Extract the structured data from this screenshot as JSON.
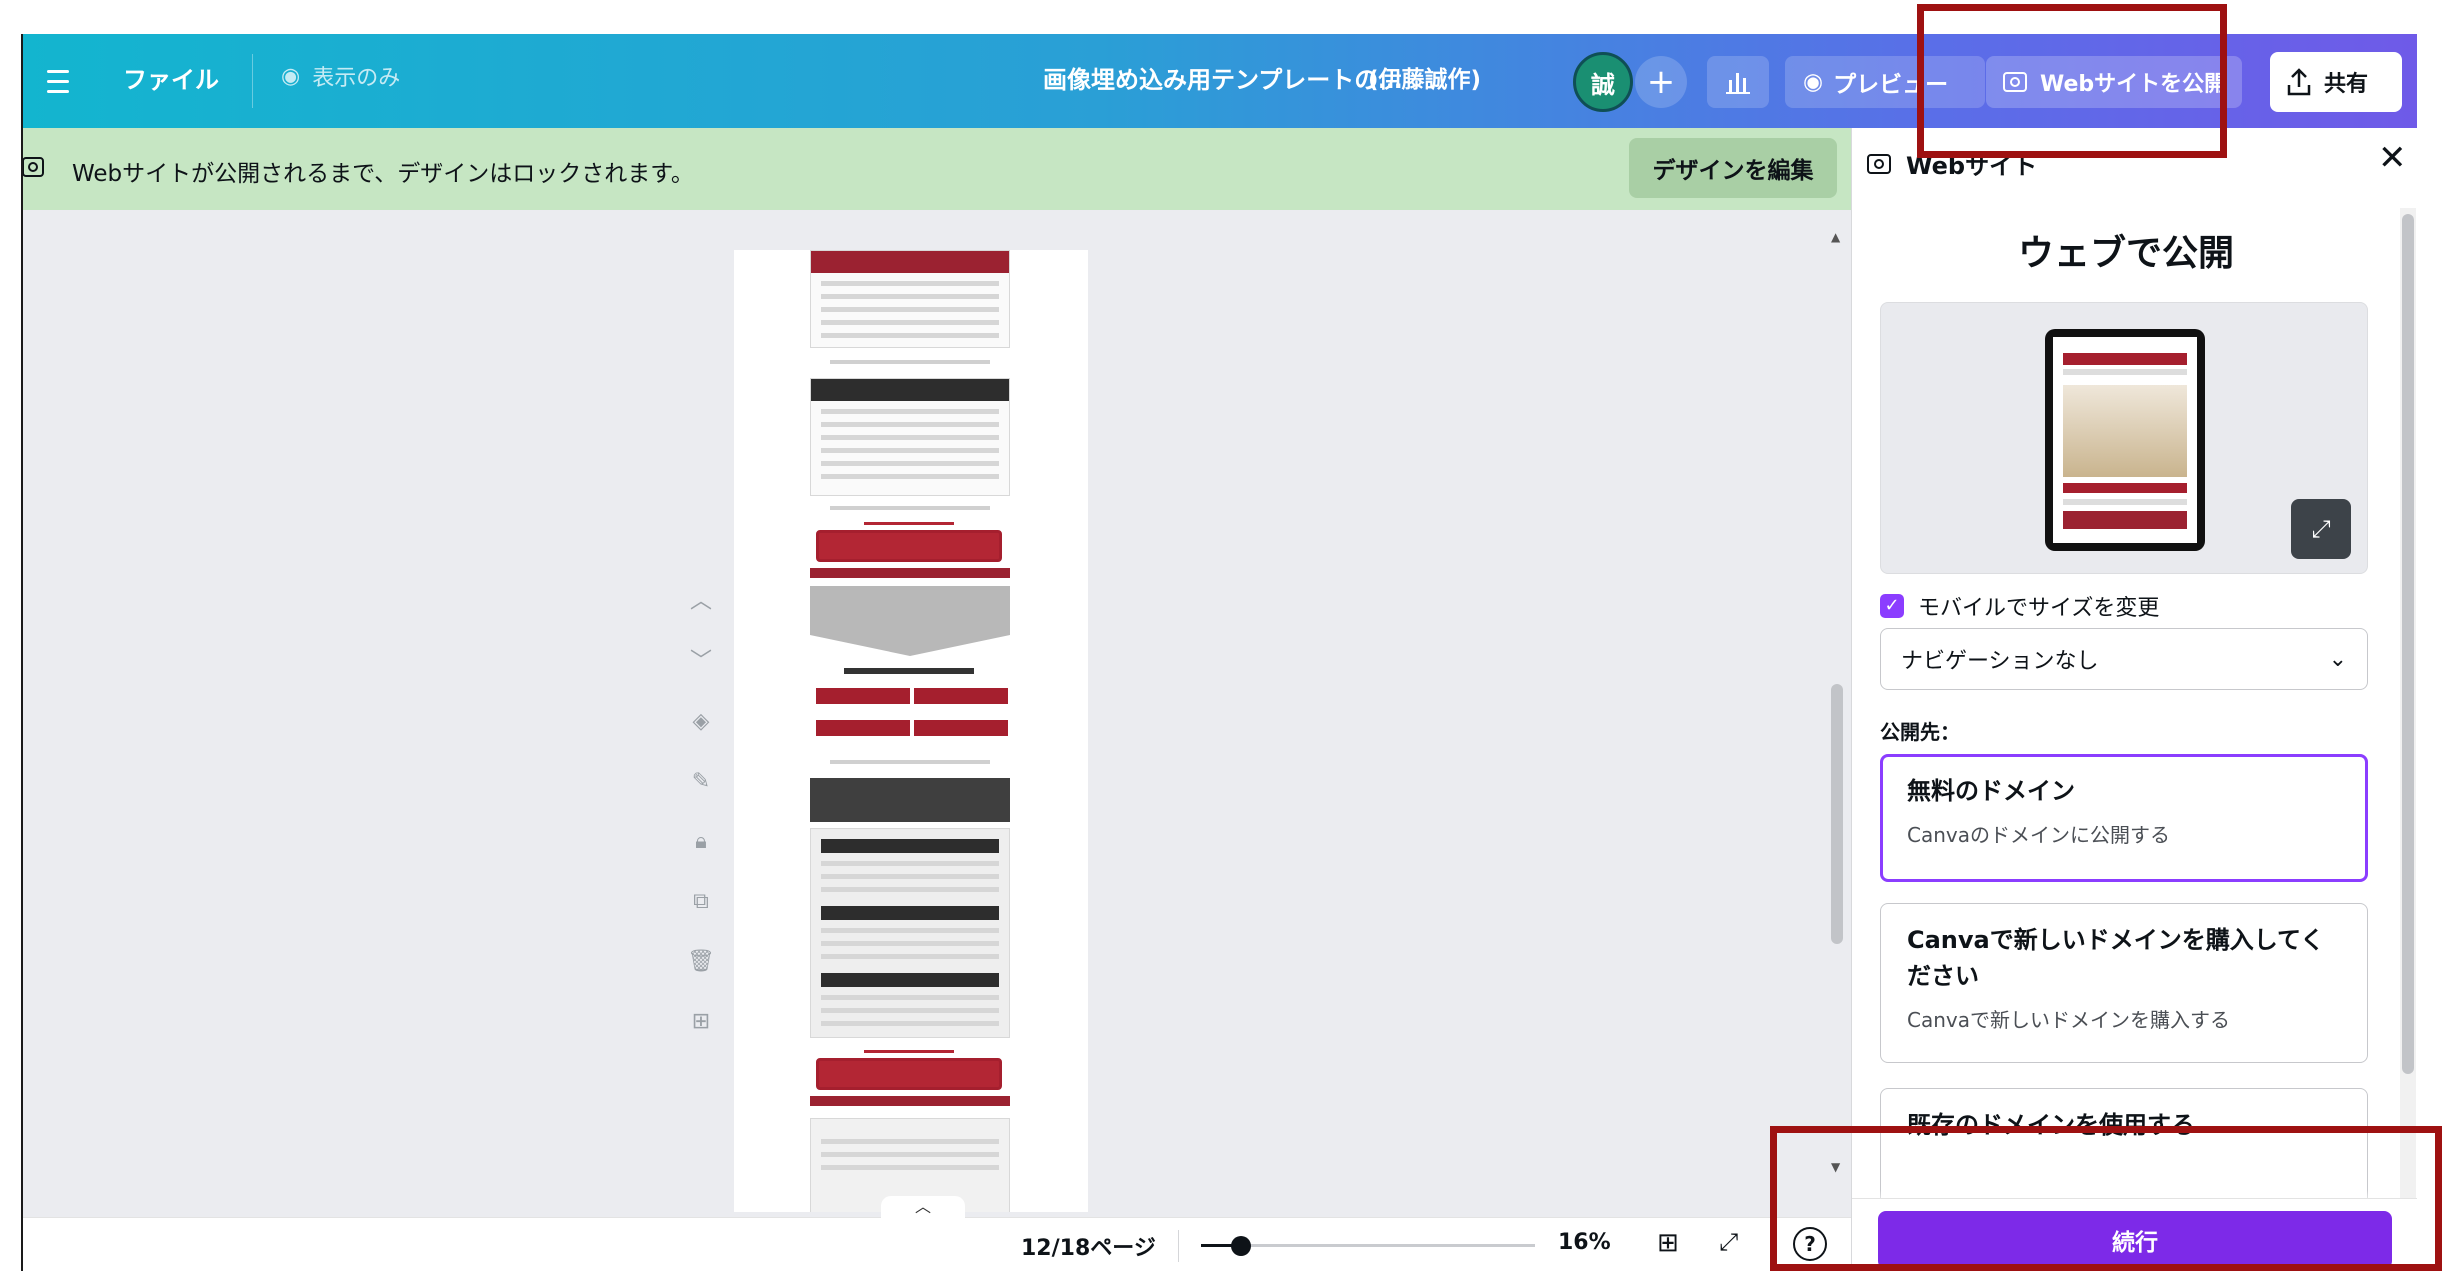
{
  "topbar": {
    "file_label": "ファイル",
    "view_only_label": "表示のみ",
    "doc_title": "画像埋め込み用テンプレートの…",
    "owner": "(伊藤誠作)",
    "avatar_initial": "誠",
    "add_label": "+",
    "preview_label": "プレビュー",
    "publish_label": "Webサイトを公開",
    "share_label": "共有"
  },
  "banner": {
    "text": "Webサイトが公開されるまで、デザインはロックされます。",
    "edit_label": "デザインを編集"
  },
  "bottombar": {
    "page_indicator": "12/18ページ",
    "zoom_level": "16%",
    "zoom_fraction": 0.16,
    "help_label": "?"
  },
  "panel": {
    "header": "Webサイト",
    "title": "ウェブで公開",
    "mobile_resize_label": "モバイルでサイズを変更",
    "mobile_resize_checked": true,
    "navigation_select": "ナビゲーションなし",
    "publish_to_label": "公開先：",
    "options": [
      {
        "title": "無料のドメイン",
        "subtitle": "Canvaのドメインに公開する",
        "selected": true
      },
      {
        "title": "Canvaで新しいドメインを購入してください",
        "subtitle": "Canvaで新しいドメインを購入する",
        "selected": false
      },
      {
        "title": "既存のドメインを使用する",
        "subtitle": "",
        "selected": false
      }
    ],
    "continue_label": "続行"
  },
  "colors": {
    "accent_purple": "#7d2ae8",
    "banner_green": "#c6e6c3",
    "highlight_red": "#9e1111"
  }
}
